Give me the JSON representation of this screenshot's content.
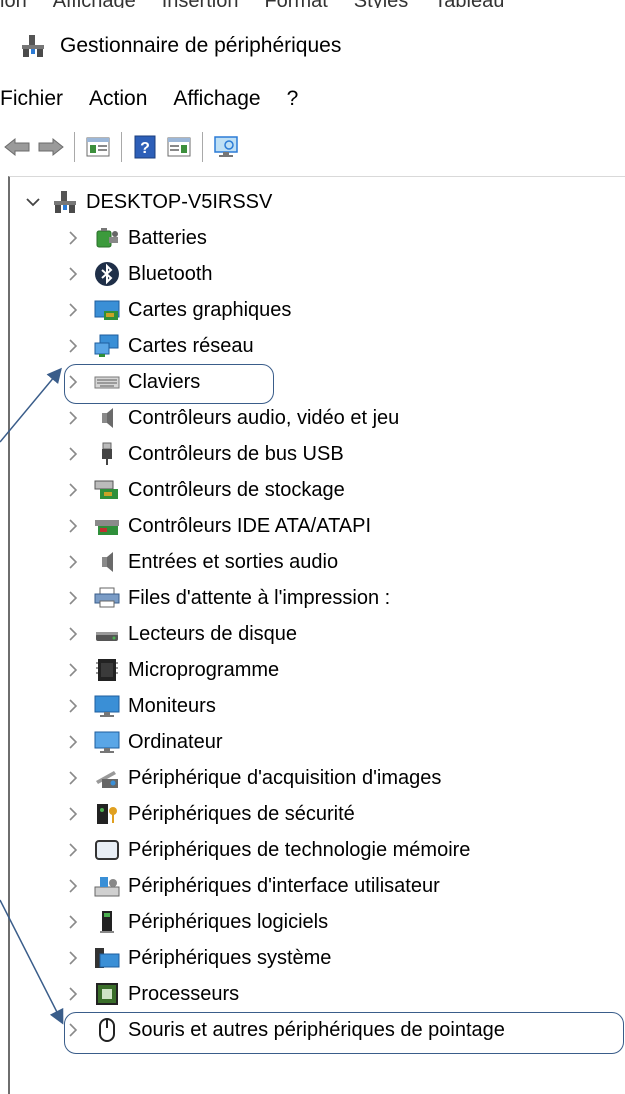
{
  "top_menu_cut": [
    "ion",
    "Affichage",
    "Insertion",
    "Format",
    "Styles",
    "Tableau"
  ],
  "window": {
    "title": "Gestionnaire de périphériques"
  },
  "menu": [
    "Fichier",
    "Action",
    "Affichage",
    "?"
  ],
  "toolbar": {
    "icons": [
      "back-arrow-icon",
      "forward-arrow-icon",
      "show-hide-console-tree-icon",
      "help-icon",
      "properties-icon",
      "scan-hardware-monitor-icon"
    ]
  },
  "tree": {
    "root": "DESKTOP-V5IRSSV",
    "items": [
      {
        "label": "Batteries",
        "icon": "battery-icon"
      },
      {
        "label": "Bluetooth",
        "icon": "bluetooth-icon"
      },
      {
        "label": "Cartes graphiques",
        "icon": "display-adapter-icon"
      },
      {
        "label": "Cartes réseau",
        "icon": "network-adapter-icon"
      },
      {
        "label": "Claviers",
        "icon": "keyboard-icon"
      },
      {
        "label": "Contrôleurs audio, vidéo et jeu",
        "icon": "speaker-icon"
      },
      {
        "label": "Contrôleurs de bus USB",
        "icon": "usb-icon"
      },
      {
        "label": "Contrôleurs de stockage",
        "icon": "storage-controller-icon"
      },
      {
        "label": "Contrôleurs IDE ATA/ATAPI",
        "icon": "ide-controller-icon"
      },
      {
        "label": "Entrées et sorties audio",
        "icon": "speaker-icon"
      },
      {
        "label": "Files d'attente à l'impression :",
        "icon": "printer-icon"
      },
      {
        "label": "Lecteurs de disque",
        "icon": "disk-drive-icon"
      },
      {
        "label": "Microprogramme",
        "icon": "firmware-chip-icon"
      },
      {
        "label": "Moniteurs",
        "icon": "monitor-icon"
      },
      {
        "label": "Ordinateur",
        "icon": "computer-icon"
      },
      {
        "label": "Périphérique d'acquisition d'images",
        "icon": "camera-scanner-icon"
      },
      {
        "label": "Périphériques de sécurité",
        "icon": "security-device-icon"
      },
      {
        "label": "Périphériques de technologie mémoire",
        "icon": "memory-technology-icon"
      },
      {
        "label": "Périphériques d'interface utilisateur",
        "icon": "hid-icon"
      },
      {
        "label": "Périphériques logiciels",
        "icon": "software-device-icon"
      },
      {
        "label": "Périphériques système",
        "icon": "system-device-icon"
      },
      {
        "label": "Processeurs",
        "icon": "processor-icon"
      },
      {
        "label": "Souris et autres périphériques de pointage",
        "icon": "mouse-icon"
      }
    ]
  },
  "highlighted": [
    "Claviers",
    "Souris et autres périphériques de pointage"
  ],
  "colors": {
    "annotation": "#3a5d8a",
    "accent_blue": "#2b7bd6"
  }
}
